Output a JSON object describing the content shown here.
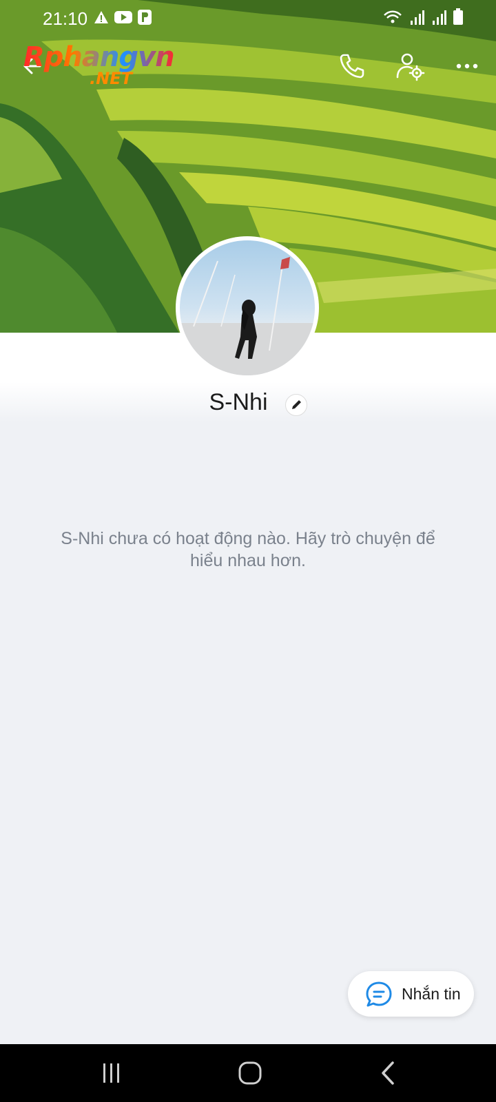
{
  "status_bar": {
    "time": "21:10"
  },
  "watermark": {
    "brand": "Rphangvn",
    "suffix": ".NET"
  },
  "icons": {
    "back": "back-arrow-icon",
    "call": "phone-icon",
    "profile_settings": "user-settings-icon",
    "more": "more-dots-icon",
    "edit": "pencil-icon",
    "message": "chat-bubble-icon"
  },
  "profile": {
    "name": "S-Nhi"
  },
  "activity": {
    "empty_message": "S-Nhi chưa có hoạt động nào. Hãy trò chuyện để hiểu nhau hơn."
  },
  "fab": {
    "label": "Nhắn tin"
  },
  "colors": {
    "page_background": "#eff1f5",
    "accent_blue": "#1f8ae6",
    "muted_text": "#7a818c",
    "nav_bar": "#000000"
  }
}
